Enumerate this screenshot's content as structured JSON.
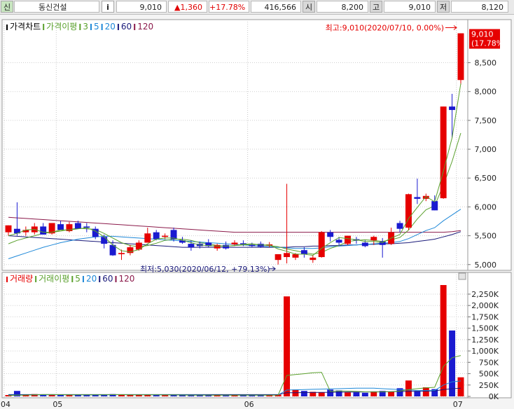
{
  "header": {
    "badge": "신",
    "stock_name": "동신건설",
    "info_label": "i",
    "price": "9,010",
    "change": "▲1,360",
    "change_pct": "+17.78%",
    "volume": "416,566",
    "open_label": "시",
    "open": "8,200",
    "high_label": "고",
    "high": "9,010",
    "low_label": "저",
    "low": "8,120"
  },
  "colors": {
    "up": "#e60000",
    "down": "#1a1ad0",
    "ma5": "#5aa02c",
    "ma20": "#1e88d8",
    "ma60": "#1a1a7a",
    "ma120": "#8b1a4a"
  },
  "chart_data": [
    {
      "type": "candlestick",
      "legend": [
        {
          "text": "가격차트",
          "color": "#000000"
        },
        {
          "text": "가격이평",
          "color": "#5aa02c"
        },
        {
          "text": "3",
          "color": "#5aa02c"
        },
        {
          "text": "5",
          "color": "#1e88d8"
        },
        {
          "text": "20",
          "color": "#1e88d8"
        },
        {
          "text": "60",
          "color": "#1a1a7a"
        },
        {
          "text": "120",
          "color": "#8b1a4a"
        }
      ],
      "ylim": [
        4900,
        9150
      ],
      "yticks": [
        5000,
        5500,
        6000,
        6500,
        7000,
        7500,
        8000,
        8500
      ],
      "ytick_labels": [
        "5,000",
        "5,500",
        "6,000",
        "6,500",
        "7,000",
        "7,500",
        "8,000",
        "8,500"
      ],
      "last_price_label": "9,010",
      "last_pct_label": "(17.78%)",
      "annotations": {
        "high": "최고:9,010(2020/07/10, 0.00%)",
        "low": "최저:5,030(2020/06/12, +79.13%)"
      },
      "x_labels": [
        {
          "text": "04",
          "index": 0
        },
        {
          "text": "05",
          "index": 6
        },
        {
          "text": "06",
          "index": 28
        },
        {
          "text": "07",
          "index": 52
        }
      ],
      "ohlc": [
        [
          5560,
          5680,
          5500,
          5680
        ],
        [
          5620,
          6080,
          5500,
          5540
        ],
        [
          5560,
          5660,
          5500,
          5600
        ],
        [
          5560,
          5720,
          5520,
          5660
        ],
        [
          5660,
          5720,
          5520,
          5520
        ],
        [
          5540,
          5720,
          5520,
          5720
        ],
        [
          5700,
          5760,
          5600,
          5600
        ],
        [
          5580,
          5740,
          5560,
          5700
        ],
        [
          5720,
          5760,
          5620,
          5620
        ],
        [
          5660,
          5720,
          5560,
          5640
        ],
        [
          5620,
          5660,
          5440,
          5480
        ],
        [
          5480,
          5520,
          5280,
          5360
        ],
        [
          5340,
          5420,
          5150,
          5160
        ],
        [
          5180,
          5260,
          5080,
          5200
        ],
        [
          5200,
          5340,
          5160,
          5300
        ],
        [
          5260,
          5420,
          5240,
          5380
        ],
        [
          5380,
          5640,
          5380,
          5540
        ],
        [
          5560,
          5600,
          5420,
          5440
        ],
        [
          5480,
          5540,
          5440,
          5500
        ],
        [
          5600,
          5640,
          5400,
          5440
        ],
        [
          5420,
          5480,
          5360,
          5380
        ],
        [
          5360,
          5420,
          5240,
          5300
        ],
        [
          5360,
          5400,
          5280,
          5320
        ],
        [
          5380,
          5440,
          5300,
          5320
        ],
        [
          5280,
          5360,
          5240,
          5340
        ],
        [
          5340,
          5400,
          5260,
          5280
        ],
        [
          5350,
          5420,
          5320,
          5380
        ],
        [
          5370,
          5420,
          5320,
          5360
        ],
        [
          5340,
          5380,
          5300,
          5320
        ],
        [
          5360,
          5400,
          5290,
          5310
        ],
        [
          5330,
          5390,
          5300,
          5350
        ],
        [
          5080,
          5180,
          5000,
          5180
        ],
        [
          5130,
          6400,
          5020,
          5200
        ],
        [
          5120,
          5200,
          5080,
          5180
        ],
        [
          5250,
          5300,
          5120,
          5180
        ],
        [
          5080,
          5160,
          5030,
          5120
        ],
        [
          5130,
          5580,
          5120,
          5560
        ],
        [
          5560,
          5600,
          5400,
          5480
        ],
        [
          5430,
          5480,
          5320,
          5380
        ],
        [
          5360,
          5500,
          5340,
          5500
        ],
        [
          5440,
          5480,
          5360,
          5420
        ],
        [
          5380,
          5420,
          5300,
          5320
        ],
        [
          5420,
          5500,
          5340,
          5480
        ],
        [
          5400,
          5460,
          5120,
          5340
        ],
        [
          5360,
          5640,
          5340,
          5560
        ],
        [
          5720,
          5760,
          5560,
          5620
        ],
        [
          5640,
          6230,
          5600,
          6220
        ],
        [
          6170,
          6490,
          6050,
          6140
        ],
        [
          6140,
          6230,
          6100,
          6190
        ],
        [
          6100,
          6200,
          5940,
          5940
        ],
        [
          6150,
          7740,
          6140,
          7740
        ],
        [
          7740,
          7960,
          7200,
          7680
        ],
        [
          8200,
          9010,
          8120,
          9010
        ]
      ],
      "ma": {
        "3": [
          5500,
          5540,
          5600,
          5610,
          5560,
          5560,
          5600,
          5600,
          5620,
          5640,
          5580,
          5480,
          5340,
          5240,
          5220,
          5260,
          5360,
          5440,
          5460,
          5460,
          5420,
          5380,
          5340,
          5330,
          5320,
          5320,
          5330,
          5350,
          5360,
          5340,
          5340,
          5270,
          5230,
          5180,
          5180,
          5160,
          5280,
          5380,
          5470,
          5450,
          5430,
          5400,
          5400,
          5380,
          5460,
          5520,
          5800,
          5990,
          6180,
          6090,
          6620,
          7200,
          8140
        ],
        "5": [
          5360,
          5420,
          5460,
          5500,
          5540,
          5560,
          5580,
          5610,
          5630,
          5620,
          5610,
          5540,
          5460,
          5380,
          5330,
          5310,
          5330,
          5370,
          5420,
          5440,
          5440,
          5420,
          5380,
          5360,
          5330,
          5320,
          5330,
          5340,
          5350,
          5340,
          5330,
          5310,
          5270,
          5240,
          5210,
          5180,
          5210,
          5280,
          5330,
          5400,
          5420,
          5430,
          5420,
          5400,
          5430,
          5470,
          5600,
          5790,
          5950,
          6020,
          6380,
          6790,
          7280
        ],
        "20": [
          5100,
          5150,
          5200,
          5250,
          5300,
          5340,
          5380,
          5410,
          5440,
          5460,
          5480,
          5490,
          5490,
          5480,
          5470,
          5460,
          5450,
          5440,
          5430,
          5420,
          5410,
          5400,
          5390,
          5380,
          5370,
          5360,
          5350,
          5340,
          5330,
          5320,
          5310,
          5300,
          5290,
          5280,
          5280,
          5280,
          5290,
          5310,
          5320,
          5330,
          5340,
          5350,
          5360,
          5370,
          5380,
          5400,
          5450,
          5520,
          5590,
          5640,
          5760,
          5860,
          5960
        ],
        "60": [
          5500,
          5490,
          5480,
          5470,
          5460,
          5450,
          5440,
          5430,
          5420,
          5410,
          5400,
          5390,
          5380,
          5370,
          5360,
          5350,
          5340,
          5330,
          5320,
          5310,
          5300,
          5300,
          5300,
          5300,
          5300,
          5300,
          5300,
          5300,
          5300,
          5300,
          5300,
          5300,
          5300,
          5310,
          5310,
          5320,
          5320,
          5330,
          5330,
          5340,
          5340,
          5350,
          5350,
          5360,
          5360,
          5370,
          5380,
          5400,
          5420,
          5440,
          5480,
          5520,
          5570
        ],
        "120": [
          5820,
          5810,
          5800,
          5790,
          5780,
          5770,
          5760,
          5750,
          5740,
          5730,
          5720,
          5710,
          5700,
          5690,
          5680,
          5670,
          5660,
          5650,
          5640,
          5630,
          5620,
          5610,
          5600,
          5590,
          5580,
          5570,
          5560,
          5560,
          5560,
          5560,
          5560,
          5560,
          5560,
          5560,
          5560,
          5560,
          5560,
          5560,
          5560,
          5560,
          5560,
          5560,
          5560,
          5560,
          5560,
          5560,
          5560,
          5560,
          5560,
          5560,
          5560,
          5570,
          5590
        ]
      }
    },
    {
      "type": "bar",
      "legend": [
        {
          "text": "거래량",
          "color": "#e60000"
        },
        {
          "text": "거래이평",
          "color": "#5aa02c"
        },
        {
          "text": "5",
          "color": "#5aa02c"
        },
        {
          "text": "20",
          "color": "#1e88d8"
        },
        {
          "text": "60",
          "color": "#1a1a7a"
        },
        {
          "text": "120",
          "color": "#8b1a4a"
        }
      ],
      "ylim": [
        0,
        2450000
      ],
      "yticks": [
        0,
        250000,
        500000,
        750000,
        1000000,
        1250000,
        1500000,
        1750000,
        2000000,
        2250000
      ],
      "ytick_labels": [
        "0K",
        "250K",
        "500K",
        "750K",
        "1,000K",
        "1,250K",
        "1,500K",
        "1,750K",
        "2,000K",
        "2,250K"
      ],
      "volumes": [
        30000,
        120000,
        40000,
        50000,
        35000,
        45000,
        40000,
        30000,
        35000,
        30000,
        40000,
        35000,
        50000,
        40000,
        30000,
        35000,
        45000,
        30000,
        25000,
        30000,
        25000,
        30000,
        25000,
        25000,
        30000,
        25000,
        25000,
        25000,
        25000,
        25000,
        25000,
        40000,
        2200000,
        150000,
        120000,
        100000,
        90000,
        150000,
        130000,
        90000,
        90000,
        80000,
        110000,
        120000,
        100000,
        180000,
        350000,
        120000,
        200000,
        160000,
        2450000,
        1450000,
        420000
      ],
      "vol_ma5": [
        20000,
        25000,
        30000,
        35000,
        40000,
        40000,
        38000,
        36000,
        35000,
        34000,
        35000,
        36000,
        38000,
        38000,
        36000,
        35000,
        36000,
        35000,
        33000,
        32000,
        30000,
        28000,
        27000,
        26000,
        26000,
        26000,
        26000,
        26000,
        26000,
        26000,
        28000,
        30000,
        460000,
        480000,
        500000,
        520000,
        530000,
        110000,
        120000,
        115000,
        110000,
        100000,
        95000,
        100000,
        105000,
        115000,
        150000,
        170000,
        190000,
        200000,
        660000,
        850000,
        900000
      ],
      "vol_ma20": [
        30000,
        31000,
        32000,
        33000,
        34000,
        35000,
        36000,
        36000,
        36000,
        36000,
        36000,
        36000,
        37000,
        37000,
        37000,
        37000,
        37000,
        37000,
        36000,
        35000,
        34000,
        33000,
        32000,
        31000,
        30000,
        30000,
        30000,
        30000,
        30000,
        30000,
        30000,
        31000,
        140000,
        145000,
        150000,
        155000,
        160000,
        165000,
        170000,
        175000,
        180000,
        180000,
        180000,
        170000,
        160000,
        150000,
        140000,
        130000,
        130000,
        130000,
        250000,
        320000,
        340000
      ],
      "vol_ma60": [
        40000,
        40000,
        40000,
        40000,
        40000,
        40000,
        40000,
        40000,
        40000,
        40000,
        40000,
        40000,
        40000,
        40000,
        40000,
        40000,
        40000,
        40000,
        40000,
        40000,
        40000,
        40000,
        40000,
        40000,
        40000,
        40000,
        40000,
        40000,
        40000,
        40000,
        40000,
        40000,
        80000,
        82000,
        84000,
        86000,
        88000,
        90000,
        92000,
        94000,
        96000,
        98000,
        100000,
        102000,
        104000,
        106000,
        110000,
        112000,
        115000,
        118000,
        150000,
        170000,
        180000
      ]
    }
  ]
}
